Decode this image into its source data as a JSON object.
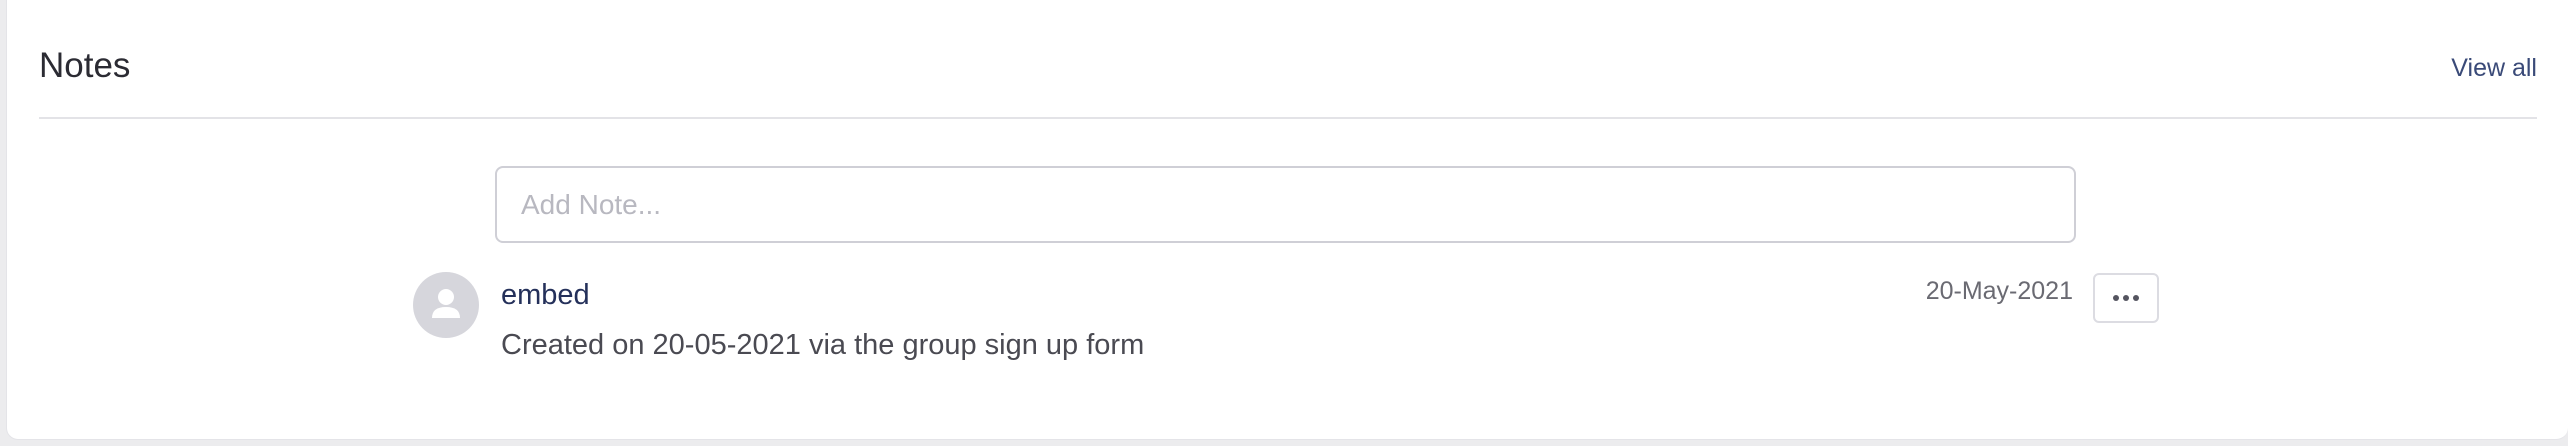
{
  "notes": {
    "title": "Notes",
    "view_all_label": "View all",
    "input": {
      "value": "",
      "placeholder": "Add Note..."
    },
    "items": [
      {
        "author": "embed",
        "body": "Created on 20-05-2021 via the group sign up form",
        "date": "20-May-2021",
        "avatar_icon": "user-icon",
        "actions_icon": "ellipsis-icon"
      }
    ]
  },
  "colors": {
    "background": "#ececee",
    "card": "#ffffff",
    "title_text": "#2b2b33",
    "link_text": "#3a4a78",
    "author_text": "#24305a",
    "avatar_bg": "#d6d6dc"
  }
}
